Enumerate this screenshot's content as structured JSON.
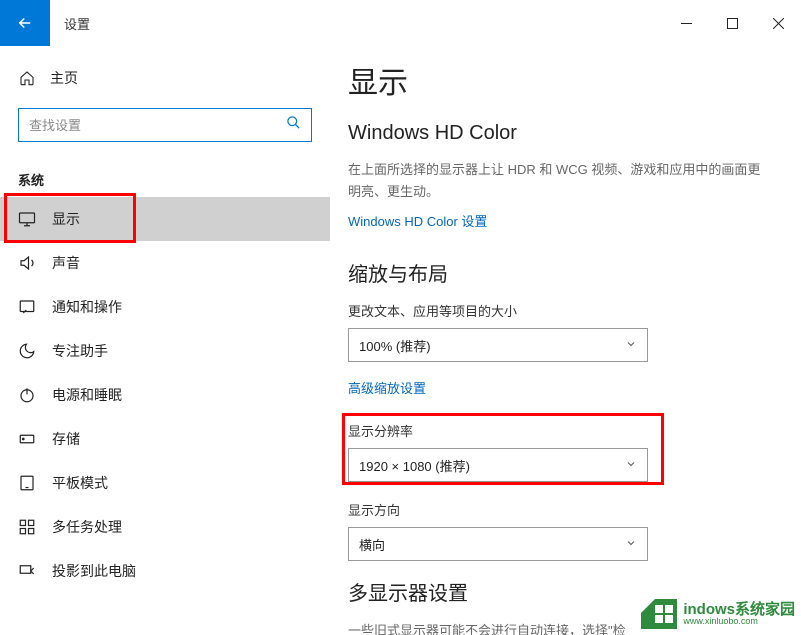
{
  "titlebar": {
    "title": "设置"
  },
  "sidebar": {
    "home": "主页",
    "search_placeholder": "查找设置",
    "category": "系统",
    "items": [
      {
        "label": "显示"
      },
      {
        "label": "声音"
      },
      {
        "label": "通知和操作"
      },
      {
        "label": "专注助手"
      },
      {
        "label": "电源和睡眠"
      },
      {
        "label": "存储"
      },
      {
        "label": "平板模式"
      },
      {
        "label": "多任务处理"
      },
      {
        "label": "投影到此电脑"
      }
    ]
  },
  "main": {
    "h1": "显示",
    "hd": {
      "title": "Windows HD Color",
      "desc": "在上面所选择的显示器上让 HDR 和 WCG 视频、游戏和应用中的画面更明亮、更生动。",
      "link": "Windows HD Color 设置"
    },
    "scale": {
      "title": "缩放与布局",
      "field_label": "更改文本、应用等项目的大小",
      "value": "100% (推荐)",
      "advanced_link": "高级缩放设置"
    },
    "resolution": {
      "label": "显示分辨率",
      "value": "1920 × 1080 (推荐)"
    },
    "orientation": {
      "label": "显示方向",
      "value": "横向"
    },
    "multi": {
      "title": "多显示器设置",
      "desc": "一些旧式显示器可能不会进行自动连接，选择\"检"
    }
  },
  "watermark": {
    "brand": "indows系统家园",
    "url": "www.xinluobo.com"
  }
}
